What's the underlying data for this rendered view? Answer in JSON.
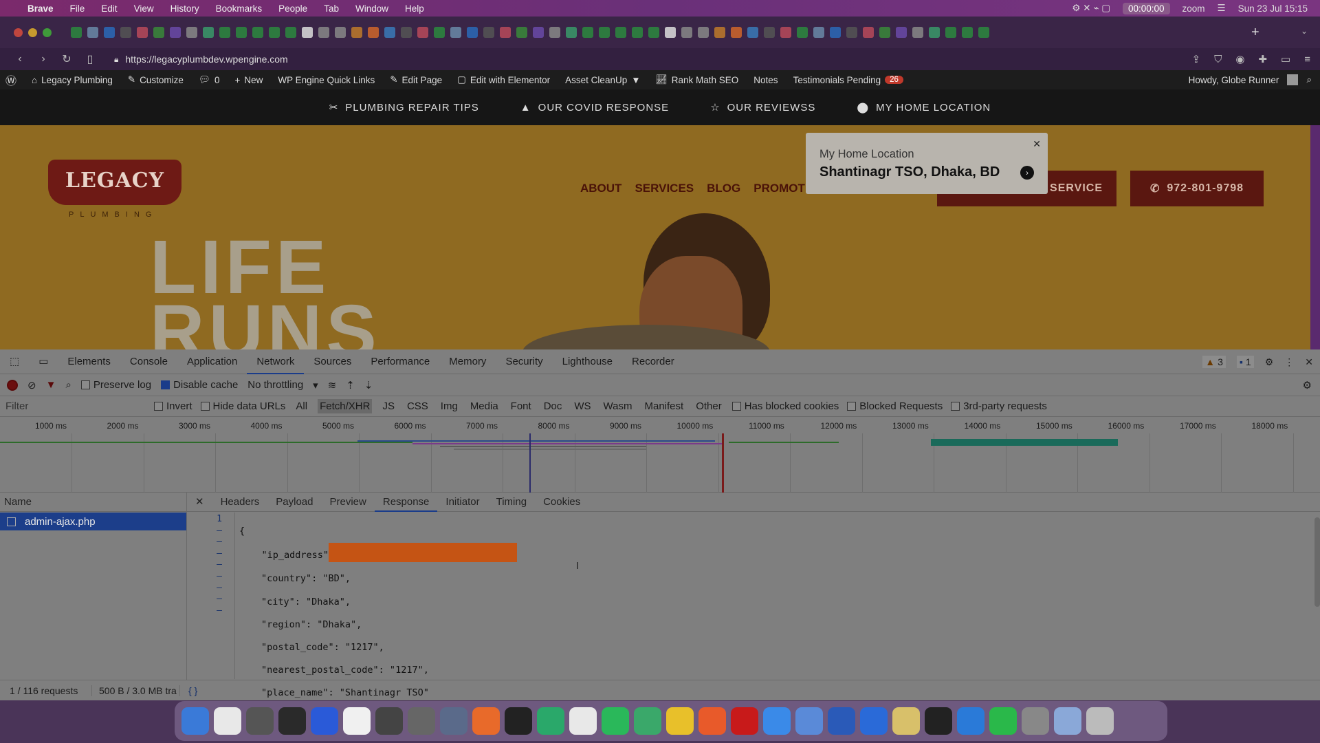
{
  "menubar": {
    "app": "Brave",
    "items": [
      "File",
      "Edit",
      "View",
      "History",
      "Bookmarks",
      "People",
      "Tab",
      "Window",
      "Help"
    ],
    "timer": "00:00:00",
    "zoom": "zoom",
    "datetime": "Sun 23 Jul  15:15"
  },
  "browser": {
    "url": "https://legacyplumbdev.wpengine.com"
  },
  "wpbar": {
    "site": "Legacy Plumbing",
    "customize": "Customize",
    "comments": "0",
    "new": "New",
    "quick_links": "WP Engine Quick Links",
    "edit_page": "Edit Page",
    "elementor": "Edit with Elementor",
    "asset_cleanup": "Asset CleanUp",
    "rank_math": "Rank Math SEO",
    "notes": "Notes",
    "testimonials": "Testimonials Pending",
    "testimonials_count": "26",
    "howdy": "Howdy, Globe Runner"
  },
  "sitetop": {
    "items": [
      "PLUMBING REPAIR TIPS",
      "OUR COVID RESPONSE",
      "OUR REVIEWSS",
      "MY HOME LOCATION"
    ]
  },
  "hero": {
    "logo": "LEGACY",
    "logo_sub": "PLUMBING",
    "headline_1": "LIFE",
    "headline_2": "RUNS",
    "nav": [
      "ABOUT",
      "SERVICES",
      "BLOG",
      "PROMOTI"
    ],
    "service_btn": "SERVICE",
    "phone": "972-801-9798"
  },
  "popup": {
    "label": "My Home Location",
    "value": "Shantinagr TSO, Dhaka, BD"
  },
  "devtools": {
    "tabs": [
      "Elements",
      "Console",
      "Application",
      "Network",
      "Sources",
      "Performance",
      "Memory",
      "Security",
      "Lighthouse",
      "Recorder"
    ],
    "active_tab": "Network",
    "warnings": "3",
    "messages": "1",
    "toolbar": {
      "preserve_log": "Preserve log",
      "disable_cache": "Disable cache",
      "throttling": "No throttling"
    },
    "filter": {
      "placeholder": "Filter",
      "invert": "Invert",
      "hide_data_urls": "Hide data URLs",
      "types": [
        "All",
        "Fetch/XHR",
        "JS",
        "CSS",
        "Img",
        "Media",
        "Font",
        "Doc",
        "WS",
        "Wasm",
        "Manifest",
        "Other"
      ],
      "active_type": "Fetch/XHR",
      "blocked_cookies": "Has blocked cookies",
      "blocked_requests": "Blocked Requests",
      "third_party": "3rd-party requests"
    },
    "timeline_ticks": [
      "1000 ms",
      "2000 ms",
      "3000 ms",
      "4000 ms",
      "5000 ms",
      "6000 ms",
      "7000 ms",
      "8000 ms",
      "9000 ms",
      "10000 ms",
      "11000 ms",
      "12000 ms",
      "13000 ms",
      "14000 ms",
      "15000 ms",
      "16000 ms",
      "17000 ms",
      "18000 ms"
    ],
    "name_header": "Name",
    "request": "admin-ajax.php",
    "detail_tabs": [
      "Headers",
      "Payload",
      "Preview",
      "Response",
      "Initiator",
      "Timing",
      "Cookies"
    ],
    "active_detail": "Response",
    "response": {
      "open": "{",
      "ip_key": "\"ip_address\"",
      "country": "\"country\": \"BD\",",
      "city": "\"city\": \"Dhaka\",",
      "region": "\"region\": \"Dhaka\",",
      "postal": "\"postal_code\": \"1217\",",
      "nearest": "\"nearest_postal_code\": \"1217\",",
      "place": "\"place_name\": \"Shantinagr TSO\"",
      "close": "}"
    },
    "gutter": [
      "1",
      "–",
      "–",
      "–",
      "–",
      "–",
      "–",
      "–",
      "–"
    ],
    "status_requests": "1 / 116 requests",
    "status_size": "500 B / 3.0 MB tra",
    "pretty_print": "{ }"
  },
  "colors": {
    "menubar": "#7b2a6c",
    "devtools_bg": "#7f7f7f",
    "hero_bg": "#8f6a21",
    "selected_row": "#1c3e8a",
    "redaction": "#c55414"
  }
}
